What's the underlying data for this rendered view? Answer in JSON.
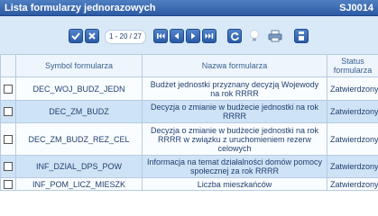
{
  "window": {
    "title": "Lista formularzy jednorazowych",
    "code": "SJ0014"
  },
  "toolbar": {
    "page_info": "1 - 20 / 27"
  },
  "table": {
    "headers": {
      "symbol": "Symbol formularza",
      "name": "Nazwa formularza",
      "status": "Status formularza"
    },
    "rows": [
      {
        "symbol": "DEC_WOJ_BUDZ_JEDN",
        "name": "Budżet jednostki przyznany decyzją Wojewody na rok RRRR",
        "status": "Zatwierdzony"
      },
      {
        "symbol": "DEC_ZM_BUDZ",
        "name": "Decyzja o zmianie w budżecie jednostki na rok RRRR",
        "status": "Zatwierdzony"
      },
      {
        "symbol": "DEC_ZM_BUDZ_REZ_CEL",
        "name": "Decyzja o zmianie w budżecie jednostki na rok RRRR w związku z uruchomieniem rezerw celowych",
        "status": "Zatwierdzony"
      },
      {
        "symbol": "INF_DZIAL_DPS_POW",
        "name": "Informacja na temat działalności domów pomocy społecznej za rok RRRR",
        "status": "Zatwierdzony"
      },
      {
        "symbol": "INF_POM_LICZ_MIESZK",
        "name": "Liczba mieszkańców",
        "status": "Zatwierdzony"
      }
    ]
  }
}
